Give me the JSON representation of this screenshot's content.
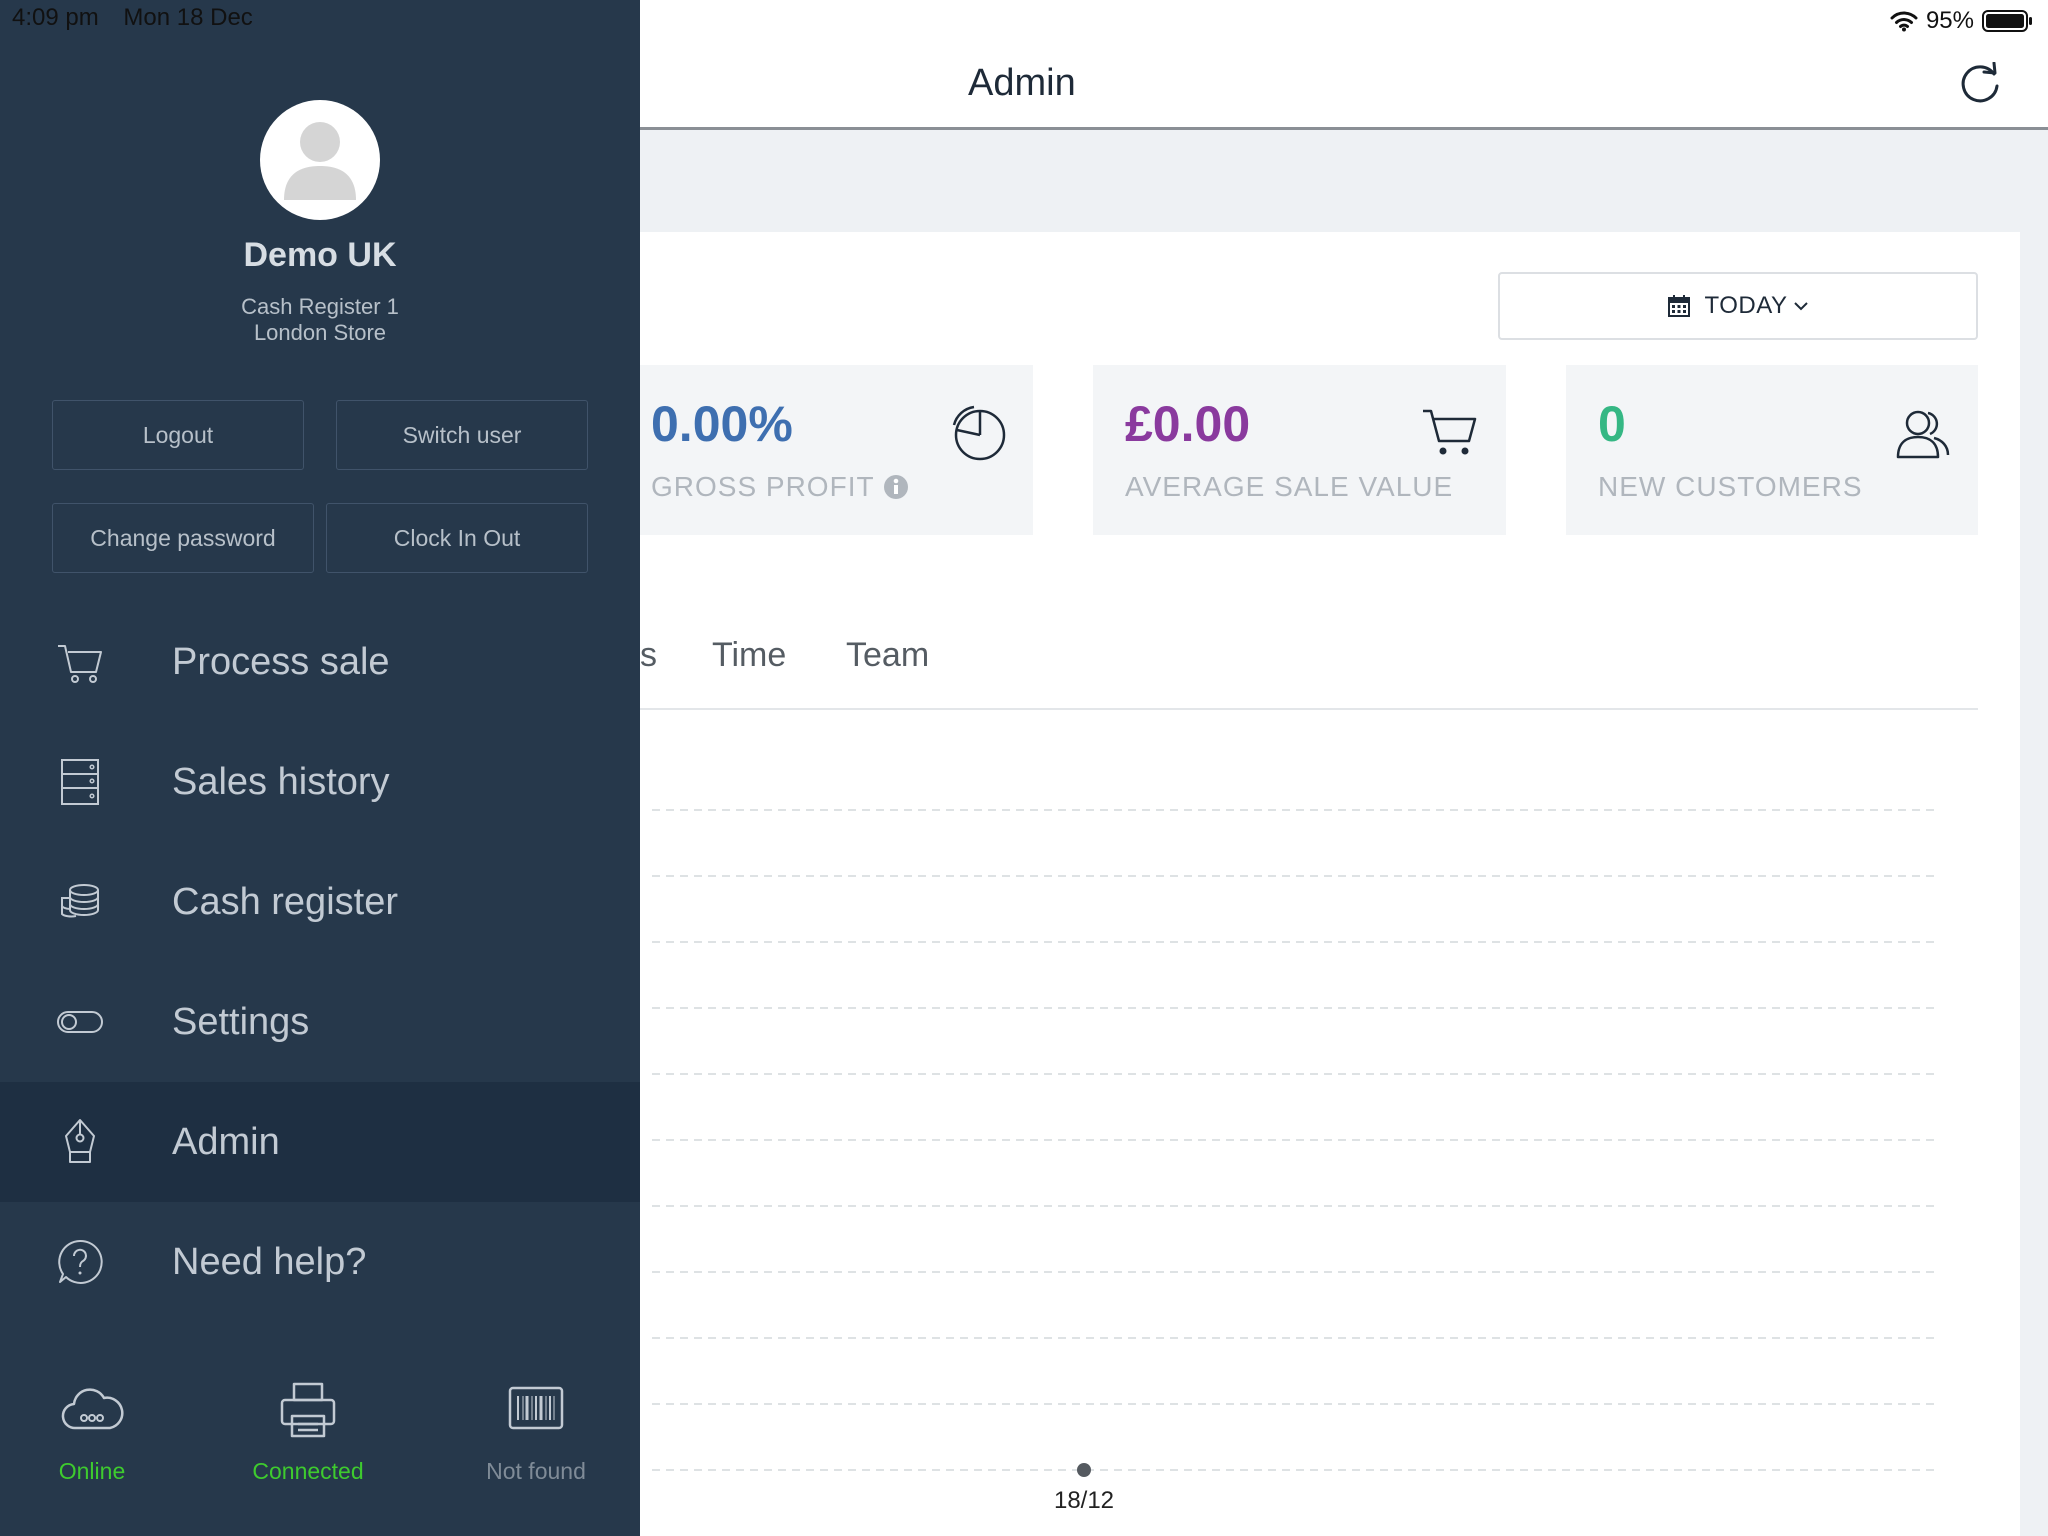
{
  "status_bar": {
    "time": "4:09 pm",
    "date": "Mon 18 Dec",
    "battery": "95%"
  },
  "header": {
    "title": "Admin"
  },
  "period_selector": {
    "label": "TODAY"
  },
  "stats": [
    {
      "value": "0.00%",
      "label": "GROSS PROFIT",
      "color": "#3e6fb0",
      "icon": "pie-chart-icon"
    },
    {
      "value": "£0.00",
      "label": "AVERAGE SALE VALUE",
      "color": "#8a3a9e",
      "icon": "cart-icon"
    },
    {
      "value": "0",
      "label": "NEW CUSTOMERS",
      "color": "#35b784",
      "icon": "users-icon"
    }
  ],
  "tabs": [
    "s",
    "Time",
    "Team"
  ],
  "chart_data": {
    "type": "line",
    "x": [
      "18/12"
    ],
    "series": [
      {
        "values": [
          0
        ]
      }
    ],
    "grid": true
  },
  "sidebar": {
    "user_name": "Demo UK",
    "register": "Cash Register 1",
    "store": "London Store",
    "buttons": {
      "logout": "Logout",
      "switch_user": "Switch user",
      "change_password": "Change password",
      "clock": "Clock In Out"
    },
    "nav": [
      {
        "label": "Process sale",
        "icon": "cart-icon"
      },
      {
        "label": "Sales history",
        "icon": "cabinet-icon"
      },
      {
        "label": "Cash register",
        "icon": "coins-icon"
      },
      {
        "label": "Settings",
        "icon": "toggle-icon"
      },
      {
        "label": "Admin",
        "icon": "pen-nib-icon",
        "active": true
      },
      {
        "label": "Need help?",
        "icon": "help-icon"
      }
    ],
    "footer": [
      {
        "label": "Online",
        "icon": "cloud-icon",
        "color": "#3ecb2e"
      },
      {
        "label": "Connected",
        "icon": "printer-icon",
        "color": "#3ecb2e"
      },
      {
        "label": "Not found",
        "icon": "barcode-icon",
        "color": "#7f8b97"
      }
    ]
  }
}
